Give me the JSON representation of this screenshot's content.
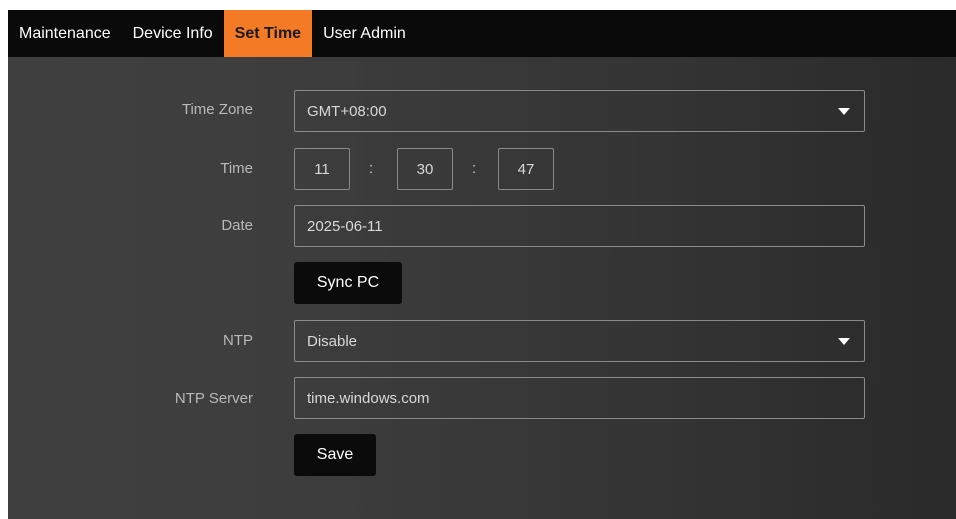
{
  "nav": {
    "tabs": [
      {
        "label": "Maintenance",
        "active": false
      },
      {
        "label": "Device Info",
        "active": false
      },
      {
        "label": "Set Time",
        "active": true
      },
      {
        "label": "User Admin",
        "active": false
      }
    ]
  },
  "form": {
    "timezone": {
      "label": "Time Zone",
      "value": "GMT+08:00"
    },
    "time": {
      "label": "Time",
      "hour": "11",
      "minute": "30",
      "second": "47",
      "separator": ":"
    },
    "date": {
      "label": "Date",
      "value": "2025-06-11"
    },
    "sync_button": "Sync PC",
    "ntp": {
      "label": "NTP",
      "value": "Disable"
    },
    "ntp_server": {
      "label": "NTP Server",
      "value": "time.windows.com"
    },
    "save_button": "Save"
  },
  "colors": {
    "accent": "#f47a26",
    "navbar": "#0a0a0a",
    "button": "#0b0b0b"
  }
}
